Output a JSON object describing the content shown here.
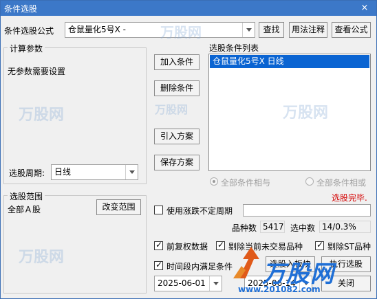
{
  "window": {
    "title": "条件选股",
    "close_icon": "×"
  },
  "formula": {
    "label": "条件选股公式",
    "value": "仓鼠量化5号X  -",
    "buttons": {
      "find": "查找",
      "usage": "用法注释",
      "view": "查看公式"
    }
  },
  "params": {
    "group_title": "计算参数",
    "no_params": "无参数需要设置",
    "period_label": "选股周期:",
    "period_value": "日线"
  },
  "actions": {
    "add": "加入条件",
    "delete": "删除条件",
    "import": "引入方案",
    "save": "保存方案"
  },
  "condition_list": {
    "title": "选股条件列表",
    "items": [
      "仓鼠量化5号X  日线"
    ]
  },
  "logic": {
    "and_label": "全部条件相与",
    "or_label": "全部条件相或"
  },
  "status": {
    "text": "选股完毕."
  },
  "range": {
    "group_title": "选股范围",
    "value": "全部Ａ股",
    "change_button": "改变范围"
  },
  "options": {
    "variable_period": "使用涨跌不定周期",
    "pre_adjusted": "前复权数据",
    "exclude_no_trade": "剔除当前未交易品种",
    "exclude_st": "剔除ST品种",
    "time_range": "时间段内满足条件"
  },
  "stats": {
    "count_label": "品种数",
    "count_value": "5417",
    "selected_label": "选中数",
    "selected_value": "14/0.3%"
  },
  "dates": {
    "start": "2025-06-01",
    "end": "2025-06-14"
  },
  "bottom_buttons": {
    "select_to_block": "选股入板块",
    "run": "执行选股",
    "close": "关闭"
  },
  "watermark": {
    "brand": "万股网",
    "url": "www.201082.com"
  },
  "colors": {
    "title_bar": "#3c78c8",
    "selection": "#0a64d2",
    "status_red": "#d40000",
    "watermark_blue": "#1f6fd6"
  }
}
